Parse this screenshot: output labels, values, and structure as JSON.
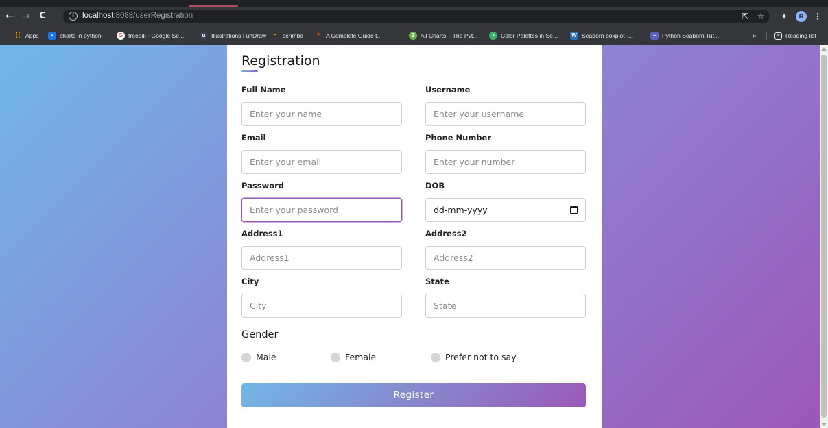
{
  "browser": {
    "url_host": "localhost",
    "url_path": ":8088/userRegistration",
    "avatar_letter": "R",
    "nav": {
      "back": "←",
      "forward": "→",
      "reload": "C"
    },
    "bookmarks": [
      {
        "label": "Apps",
        "icon": "apps-grid-icon",
        "color": "#f9ab00"
      },
      {
        "label": "charts in python",
        "icon": "site-favicon",
        "color": "#1a73e8"
      },
      {
        "label": "freepik - Google Se...",
        "icon": "google-icon",
        "color": "#ea4335"
      },
      {
        "label": "Illustrations | unDraw",
        "icon": "undraw-icon",
        "color": "#3f3d56"
      },
      {
        "label": "scrimba",
        "icon": "scrimba-icon",
        "color": "#2b283a"
      },
      {
        "label": "A Complete Guide t...",
        "icon": "css-tricks-icon",
        "color": "#e8590c"
      },
      {
        "label": "All Charts – The Pyt...",
        "icon": "python-graph-icon",
        "color": "#69b34c"
      },
      {
        "label": "Color Palettes in Se...",
        "icon": "stackabuse-icon",
        "color": "#3ab06b"
      },
      {
        "label": "Seaborn boxplot -...",
        "icon": "w-icon",
        "color": "#2a6ebb"
      },
      {
        "label": "Python Seaborn Tut...",
        "icon": "list-icon",
        "color": "#5b5fc7"
      }
    ],
    "more_bookmarks": "»",
    "reading_list": "Reading list"
  },
  "form": {
    "title": "Registration",
    "fields": {
      "full_name": {
        "label": "Full Name",
        "placeholder": "Enter your name"
      },
      "username": {
        "label": "Username",
        "placeholder": "Enter your username"
      },
      "email": {
        "label": "Email",
        "placeholder": "Enter your email"
      },
      "phone": {
        "label": "Phone Number",
        "placeholder": "Enter your number"
      },
      "password": {
        "label": "Password",
        "placeholder": "Enter your password"
      },
      "dob": {
        "label": "DOB",
        "placeholder": "dd-mm-yyyy"
      },
      "address1": {
        "label": "Address1",
        "placeholder": "Address1"
      },
      "address2": {
        "label": "Address2",
        "placeholder": "Address2"
      },
      "city": {
        "label": "City",
        "placeholder": "City"
      },
      "state": {
        "label": "State",
        "placeholder": "State"
      }
    },
    "gender": {
      "title": "Gender",
      "options": [
        "Male",
        "Female",
        "Prefer not to say"
      ]
    },
    "submit_label": "Register"
  },
  "colors": {
    "gradient_start": "#71b7e6",
    "gradient_end": "#9b59b6"
  }
}
